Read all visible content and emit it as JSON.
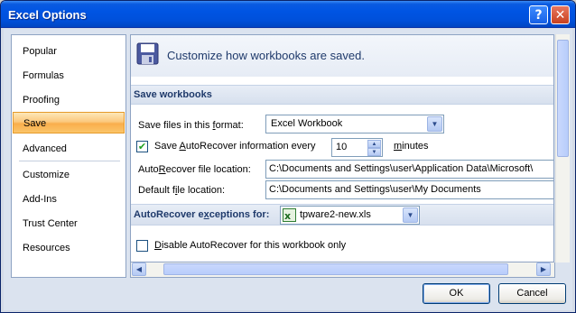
{
  "window": {
    "title": "Excel Options",
    "help_icon": "help-icon",
    "close_icon": "close-icon"
  },
  "sidebar": {
    "items": [
      {
        "label": "Popular"
      },
      {
        "label": "Formulas"
      },
      {
        "label": "Proofing"
      },
      {
        "label": "Save",
        "selected": true
      },
      {
        "label": "Advanced"
      },
      {
        "label": "Customize"
      },
      {
        "label": "Add-Ins"
      },
      {
        "label": "Trust Center"
      },
      {
        "label": "Resources"
      }
    ]
  },
  "content": {
    "heading": "Customize how workbooks are saved.",
    "heading_icon": "floppy-disk-icon",
    "section_save": "Save workbooks",
    "format_label_pre": "Save files in this ",
    "format_label_u": "f",
    "format_label_post": "ormat:",
    "format_value": "Excel Workbook",
    "autorecover_check_pre": "Save ",
    "autorecover_check_u": "A",
    "autorecover_check_post": "utoRecover information every",
    "autorecover_checked": true,
    "autorecover_minutes": "10",
    "minutes_u": "m",
    "minutes_post": "inutes",
    "ar_location_pre": "Auto",
    "ar_location_u": "R",
    "ar_location_post": "ecover file location:",
    "ar_location_value": "C:\\Documents and Settings\\user\\Application Data\\Microsoft\\",
    "default_location_pre": "Default f",
    "default_location_u": "i",
    "default_location_post": "le location:",
    "default_location_value": "C:\\Documents and Settings\\user\\My Documents",
    "section_exceptions_pre": "AutoRecover e",
    "section_exceptions_u": "x",
    "section_exceptions_post": "ceptions for:",
    "exceptions_workbook": "tpware2-new.xls",
    "exceptions_workbook_icon": "excel-file-icon",
    "disable_pre": "",
    "disable_u": "D",
    "disable_post": "isable AutoRecover for this workbook only",
    "disable_checked": false
  },
  "buttons": {
    "ok": "OK",
    "cancel": "Cancel"
  },
  "colors": {
    "titlebar": "#0054e3",
    "selected_item": "#fbc97e",
    "frame": "#dbe3ef"
  }
}
